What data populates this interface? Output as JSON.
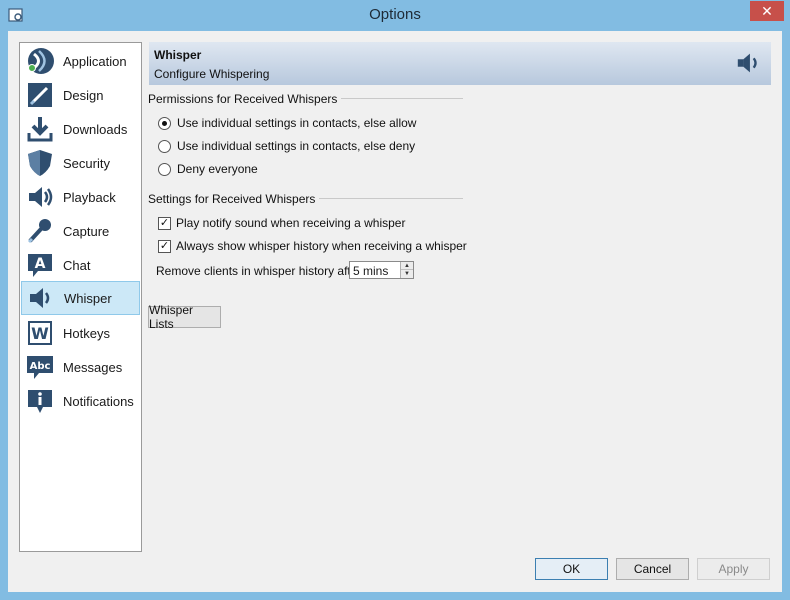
{
  "window": {
    "title": "Options",
    "close_glyph": "✕"
  },
  "sidebar": {
    "items": [
      {
        "label": "Application",
        "icon": "teamspeak-logo-icon"
      },
      {
        "label": "Design",
        "icon": "design-pen-icon"
      },
      {
        "label": "Downloads",
        "icon": "download-arrow-icon"
      },
      {
        "label": "Security",
        "icon": "shield-icon"
      },
      {
        "label": "Playback",
        "icon": "speaker-icon"
      },
      {
        "label": "Capture",
        "icon": "microphone-icon"
      },
      {
        "label": "Chat",
        "icon": "chat-bubble-icon"
      },
      {
        "label": "Whisper",
        "icon": "whisper-speaker-icon"
      },
      {
        "label": "Hotkeys",
        "icon": "hotkeys-w-icon"
      },
      {
        "label": "Messages",
        "icon": "messages-abc-icon"
      },
      {
        "label": "Notifications",
        "icon": "info-icon"
      }
    ],
    "selected_index": 7
  },
  "header": {
    "title": "Whisper",
    "subtitle": "Configure Whispering",
    "icon": "speaker-icon"
  },
  "permissions": {
    "group_title": "Permissions for Received Whispers",
    "options": [
      {
        "label": "Use individual settings in contacts, else allow",
        "checked": true
      },
      {
        "label": "Use individual settings in contacts, else deny",
        "checked": false
      },
      {
        "label": "Deny everyone",
        "checked": false
      }
    ]
  },
  "settings": {
    "group_title": "Settings for Received Whispers",
    "checkboxes": [
      {
        "label": "Play notify sound when receiving a whisper",
        "checked": true
      },
      {
        "label": "Always show whisper history when receiving a whisper",
        "checked": true
      }
    ],
    "remove_label": "Remove clients in whisper history after",
    "remove_value": "5 mins"
  },
  "buttons": {
    "whisper_lists": "Whisper Lists",
    "ok": "OK",
    "cancel": "Cancel",
    "apply": "Apply"
  },
  "colors": {
    "selected_bg": "#cce8f7",
    "icon_blue": "#2f4e6f",
    "titlebar": "#82bce2"
  }
}
